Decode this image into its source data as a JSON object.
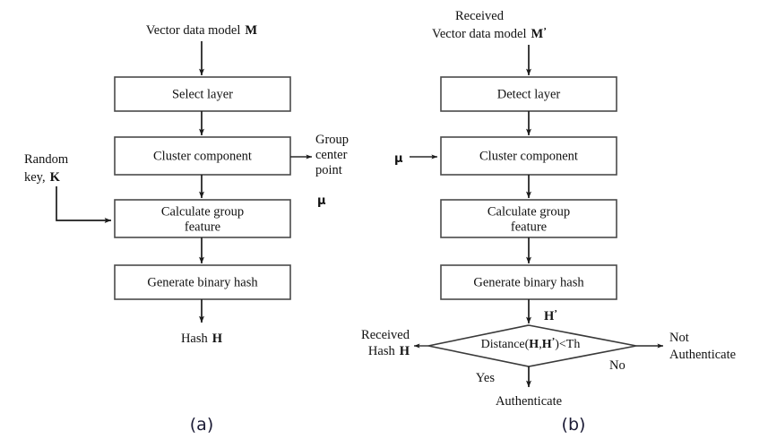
{
  "figure": {
    "caption_a": "(a)",
    "caption_b": "(b)"
  },
  "diagram_a": {
    "input_label": "Vector data model",
    "input_symbol": "M",
    "boxes": [
      {
        "label": "Select layer"
      },
      {
        "label": "Cluster component"
      },
      {
        "label_line1": "Calculate group",
        "label_line2": "feature"
      },
      {
        "label": "Generate binary hash"
      }
    ],
    "side_input": {
      "line1": "Random",
      "line2": "key,",
      "symbol": "K"
    },
    "side_output": {
      "line1": "Group",
      "line2": "center",
      "line3": "point",
      "symbol": "μ"
    },
    "output_label": "Hash",
    "output_symbol": "H"
  },
  "diagram_b": {
    "input_line1": "Received",
    "input_line2": "Vector data model",
    "input_symbol": "M",
    "input_symbol_prime": "’",
    "boxes": [
      {
        "label": "Detect layer"
      },
      {
        "label": "Cluster component"
      },
      {
        "label_line1": "Calculate group",
        "label_line2": "feature"
      },
      {
        "label": "Generate binary hash"
      }
    ],
    "side_input_symbol": "μ",
    "hash_out_symbol": "H",
    "hash_out_prime": "’",
    "decision": {
      "text_prefix": "Distance(",
      "text_h": "H",
      "text_comma": ",",
      "text_h2": "H",
      "text_prime": "’",
      "text_suffix": ")<Th"
    },
    "received_hash": {
      "line1": "Received",
      "line2": "Hash",
      "symbol": "H"
    },
    "branch_no_label": "No",
    "branch_yes_label": "Yes",
    "result_not_auth_line1": "Not",
    "result_not_auth_line2": "Authenticate",
    "result_auth": "Authenticate"
  },
  "colors": {
    "box_stroke": "#4a4a4a",
    "line": "#1c1c1c",
    "text": "#111111",
    "caption": "#1b1b35",
    "background": "#ffffff"
  }
}
